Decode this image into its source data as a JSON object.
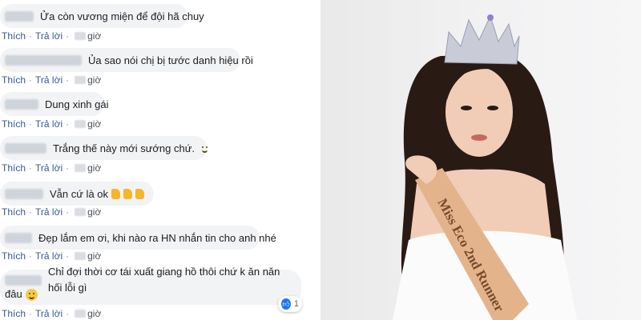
{
  "actions": {
    "like": "Thích",
    "reply": "Trả lời",
    "sep": "·",
    "time_unit": "giờ"
  },
  "comments": [
    {
      "text": "Ửa còn vương miện để đội hã chuy"
    },
    {
      "text": "Ủa sao nói chị bị tước danh hiệu rồi"
    },
    {
      "text": "Dung xinh gái"
    },
    {
      "text": "Trắng thế này mới sướng chứ."
    },
    {
      "text": "Vẫn cứ là ok"
    },
    {
      "text": "Đẹp lắm em ơi, khi nào ra HN nhắn tin cho anh nhé"
    },
    {
      "text": "Chỉ đợi thời cơ tái xuất giang hồ thôi chứ k ăn năn hối lỗi gì",
      "text_line2": "đâu"
    }
  ],
  "reaction": {
    "count": "1",
    "icon": "like-icon"
  },
  "photo": {
    "sash_text": "Miss Eco 2nd Runner",
    "colors": {
      "sash": "#e3b48c",
      "sash_text": "#7a4a2a",
      "hair": "#2a1a14",
      "skin": "#f1cdb8",
      "dress": "#fbfbfb",
      "crown": "#c9ccd6"
    }
  }
}
